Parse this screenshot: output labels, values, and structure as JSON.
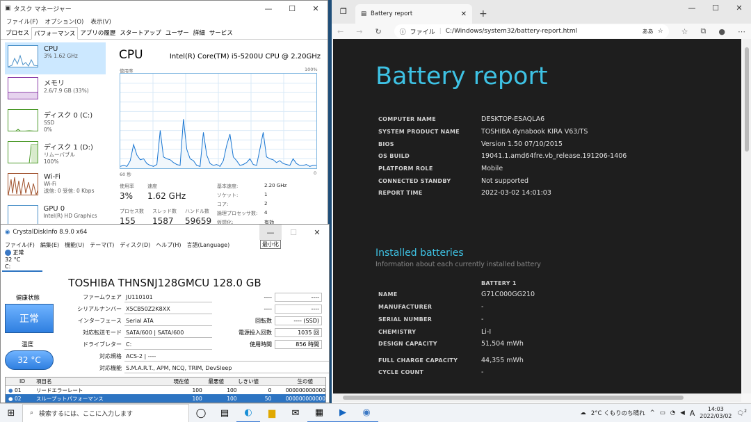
{
  "taskmgr": {
    "title": "タスク マネージャー",
    "menu": [
      "ファイル(F)",
      "オプション(O)",
      "表示(V)"
    ],
    "tabs": [
      "プロセス",
      "パフォーマンス",
      "アプリの履歴",
      "スタートアップ",
      "ユーザー",
      "詳細",
      "サービス"
    ],
    "active_tab": "パフォーマンス",
    "side": [
      {
        "label": "CPU",
        "sub1": "3% 1.62 GHz",
        "sub2": ""
      },
      {
        "label": "メモリ",
        "sub1": "2.6/7.9 GB (33%)",
        "sub2": ""
      },
      {
        "label": "ディスク 0 (C:)",
        "sub1": "SSD",
        "sub2": "0%"
      },
      {
        "label": "ディスク 1 (D:)",
        "sub1": "リムーバブル",
        "sub2": "100%"
      },
      {
        "label": "Wi-Fi",
        "sub1": "Wi-Fi",
        "sub2": "送信: 0 受信: 0 Kbps"
      },
      {
        "label": "GPU 0",
        "sub1": "Intel(R) HD Graphics ...",
        "sub2": ""
      }
    ],
    "cpu_title": "CPU",
    "cpu_model": "Intel(R) Core(TM) i5-5200U CPU @ 2.20GHz",
    "graph_top_left": "使用率",
    "graph_top_right": "100%",
    "graph_bottom_left": "60 秒",
    "graph_bottom_right": "0",
    "stats": {
      "usage_lbl": "使用率",
      "usage": "3%",
      "speed_lbl": "速度",
      "speed": "1.62 GHz",
      "proc_lbl": "プロセス数",
      "proc": "155",
      "thread_lbl": "スレッド数",
      "thread": "1587",
      "handle_lbl": "ハンドル数",
      "handle": "59659",
      "base_lbl": "基本速度:",
      "base": "2.20 GHz",
      "socket_lbl": "ソケット:",
      "socket": "1",
      "core_lbl": "コア:",
      "core": "2",
      "logical_lbl": "論理プロセッサ数:",
      "logical": "4",
      "virt_lbl": "仮想化:",
      "virt": "有効"
    },
    "cpu_series": [
      2,
      3,
      2,
      8,
      25,
      14,
      9,
      10,
      5,
      3,
      2,
      4,
      40,
      12,
      10,
      9,
      6,
      4,
      3,
      52,
      20,
      10,
      8,
      3,
      2,
      38,
      14,
      5,
      3,
      4,
      2,
      8,
      24,
      36,
      12,
      8,
      3,
      4,
      6,
      10,
      4,
      3,
      20,
      38,
      12,
      10,
      9,
      6,
      8,
      5,
      4,
      3,
      10,
      5,
      3,
      3,
      4,
      2,
      3,
      3
    ]
  },
  "cdi": {
    "title": "CrystalDiskInfo 8.9.0 x64",
    "menu": [
      "ファイル(F)",
      "編集(E)",
      "機能(U)",
      "テーマ(T)",
      "ディスク(D)",
      "ヘルプ(H)",
      "言語(Language)"
    ],
    "tooltip": "最小化",
    "disk_tab": {
      "status": "正常",
      "temp": "32 °C",
      "letter": "C:"
    },
    "drive_title": "TOSHIBA THNSNJ128GMCU 128.0 GB",
    "health_label": "健康状態",
    "health": "正常",
    "temp_label": "温度",
    "temp": "32 °C",
    "info": [
      {
        "k": "ファームウェア",
        "v": "JU110101"
      },
      {
        "k": "シリアルナンバー",
        "v": "X5CB50Z2K8XX"
      },
      {
        "k": "インターフェース",
        "v": "Serial ATA"
      },
      {
        "k": "対応転送モード",
        "v": "SATA/600 | SATA/600"
      },
      {
        "k": "ドライブレター",
        "v": "C:"
      },
      {
        "k": "対応規格",
        "v": "ACS-2 | ----"
      },
      {
        "k": "対応機能",
        "v": "S.M.A.R.T., APM, NCQ, TRIM, DevSleep"
      }
    ],
    "rinfo": [
      {
        "k": "----",
        "v": "----"
      },
      {
        "k": "----",
        "v": "----"
      },
      {
        "k": "回転数",
        "v": "---- (SSD)"
      },
      {
        "k": "電源投入回数",
        "v": "1035 回"
      },
      {
        "k": "使用時間",
        "v": "856 時間"
      }
    ],
    "smart_headers": [
      "ID",
      "項目名",
      "現在値",
      "最悪値",
      "しきい値",
      "生の値"
    ],
    "smart_rows": [
      [
        "01",
        "リードエラーレート",
        "100",
        "100",
        "0",
        "000000000000"
      ],
      [
        "02",
        "スループットパフォーマンス",
        "100",
        "100",
        "50",
        "000000000000"
      ]
    ]
  },
  "edge": {
    "tab_title": "Battery report",
    "address_label": "ファイル",
    "address": "C:/Windows/system32/battery-report.html",
    "report_title": "Battery report",
    "system": [
      {
        "k": "COMPUTER NAME",
        "v": "DESKTOP-ESAQLA6"
      },
      {
        "k": "SYSTEM PRODUCT NAME",
        "v": "TOSHIBA dynabook KIRA V63/TS"
      },
      {
        "k": "BIOS",
        "v": "Version 1.50 07/10/2015"
      },
      {
        "k": "OS BUILD",
        "v": "19041.1.amd64fre.vb_release.191206-1406"
      },
      {
        "k": "PLATFORM ROLE",
        "v": "Mobile"
      },
      {
        "k": "CONNECTED STANDBY",
        "v": "Not supported"
      },
      {
        "k": "REPORT TIME",
        "v": "2022-03-02  14:01:03"
      }
    ],
    "section_title": "Installed batteries",
    "section_sub": "Information about each currently installed battery",
    "battery_header": "BATTERY 1",
    "battery": [
      {
        "k": "NAME",
        "v": "G71C000GG210"
      },
      {
        "k": "MANUFACTURER",
        "v": "-"
      },
      {
        "k": "SERIAL NUMBER",
        "v": "-"
      },
      {
        "k": "CHEMISTRY",
        "v": "Li-I"
      },
      {
        "k": "DESIGN CAPACITY",
        "v": "51,504 mWh"
      },
      {
        "k": "FULL CHARGE CAPACITY",
        "v": "44,355 mWh"
      },
      {
        "k": "CYCLE COUNT",
        "v": "-"
      }
    ]
  },
  "taskbar": {
    "search_placeholder": "検索するには、ここに入力します",
    "weather": "2°C くもりのち晴れ",
    "ime": "A",
    "time": "14:03",
    "date": "2022/03/02",
    "notif_count": "2"
  },
  "colors": {
    "accent": "#3ec2e4",
    "health": "#2f7fe0",
    "selection": "#cce8ff"
  }
}
